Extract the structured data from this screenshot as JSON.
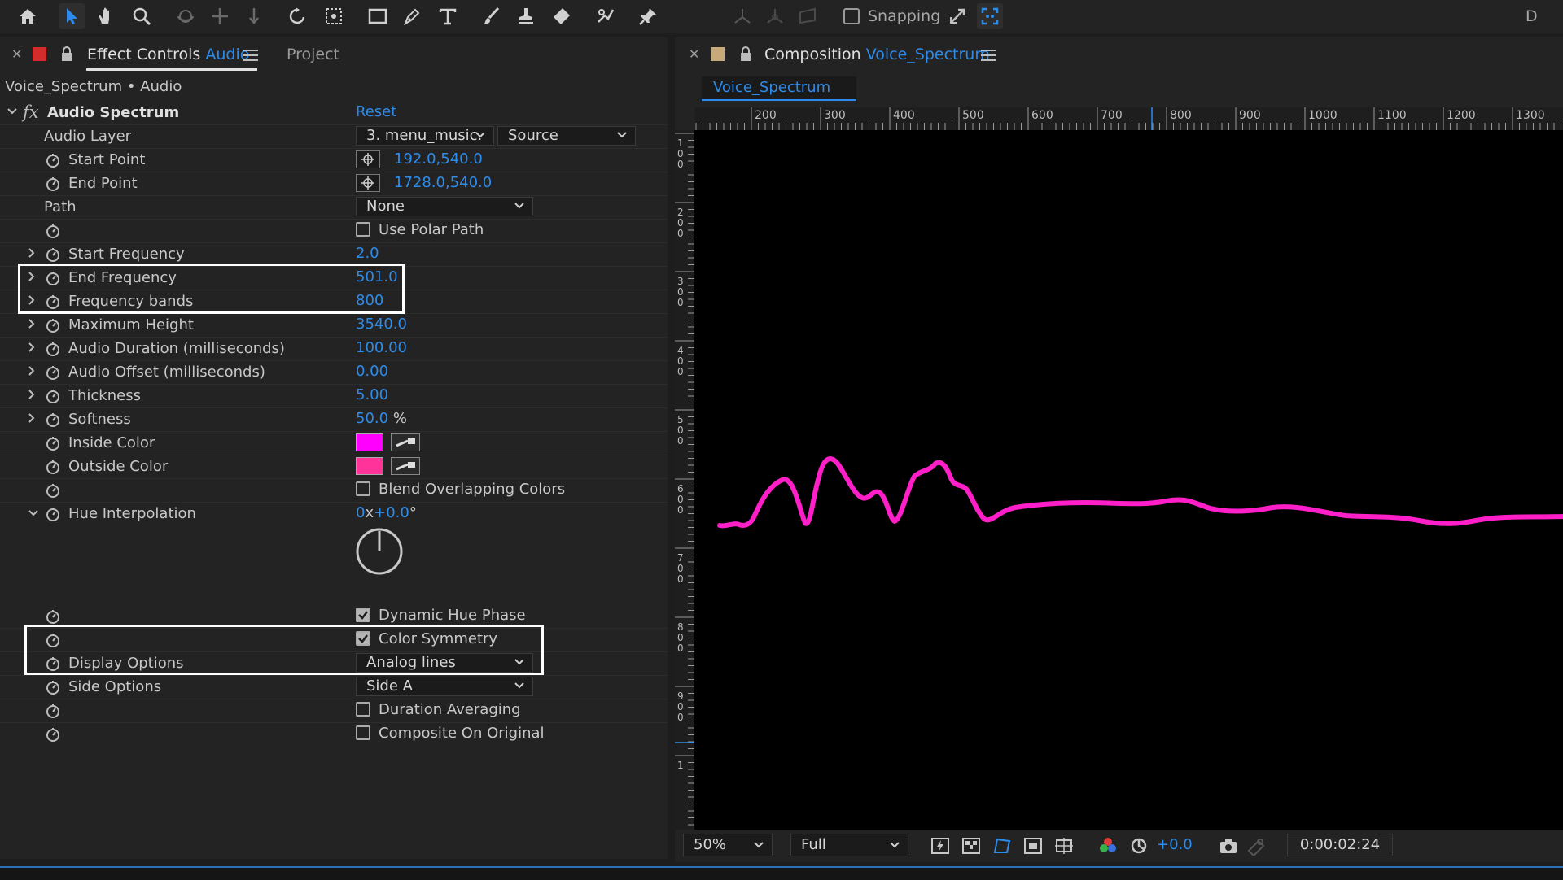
{
  "toolbar": {
    "snapping_label": "Snapping",
    "right_label": "D"
  },
  "effect_controls": {
    "tab_title_prefix": "Effect Controls",
    "tab_title_layer": "Audio",
    "label_color": "#d42c2c",
    "project_tab": "Project",
    "layer_path": "Voice_Spectrum • Audio",
    "effect": {
      "fx_label": "fx",
      "name": "Audio Spectrum",
      "reset_label": "Reset"
    },
    "audio_layer": {
      "label": "Audio Layer",
      "layer_value": "3. menu_music.",
      "source_value": "Source"
    },
    "start_point": {
      "label": "Start Point",
      "value": "192.0,540.0"
    },
    "end_point": {
      "label": "End Point",
      "value": "1728.0,540.0"
    },
    "path": {
      "label": "Path",
      "value": "None"
    },
    "use_polar_path": {
      "label": "Use Polar Path",
      "checked": false
    },
    "start_frequency": {
      "label": "Start Frequency",
      "value": "2.0"
    },
    "end_frequency": {
      "label": "End Frequency",
      "value": "501.0"
    },
    "frequency_bands": {
      "label": "Frequency bands",
      "value": "800"
    },
    "maximum_height": {
      "label": "Maximum Height",
      "value": "3540.0"
    },
    "audio_duration": {
      "label": "Audio Duration (milliseconds)",
      "value": "100.00"
    },
    "audio_offset": {
      "label": "Audio Offset (milliseconds)",
      "value": "0.00"
    },
    "thickness": {
      "label": "Thickness",
      "value": "5.00"
    },
    "softness": {
      "label": "Softness",
      "value": "50.0",
      "unit": "%"
    },
    "inside_color": {
      "label": "Inside Color",
      "color": "#ff00ff"
    },
    "outside_color": {
      "label": "Outside Color",
      "color": "#ff3399"
    },
    "blend_overlapping": {
      "label": "Blend Overlapping Colors",
      "checked": false
    },
    "hue_interpolation": {
      "label": "Hue Interpolation",
      "revolutions": "0",
      "x_label": "x",
      "degrees": "+0.0",
      "degree_unit": "°"
    },
    "dynamic_hue_phase": {
      "label": "Dynamic Hue Phase",
      "checked": true
    },
    "color_symmetry": {
      "label": "Color Symmetry",
      "checked": true
    },
    "display_options": {
      "label": "Display Options",
      "value": "Analog lines"
    },
    "side_options": {
      "label": "Side Options",
      "value": "Side A"
    },
    "duration_averaging": {
      "label": "Duration Averaging",
      "checked": false
    },
    "composite_on_original": {
      "label": "Composite On Original",
      "checked": false
    }
  },
  "composition": {
    "tab_title_prefix": "Composition",
    "tab_title_name": "Voice_Spectrum",
    "label_color": "#c8a97a",
    "subtab": "Voice_Spectrum",
    "ruler_h_labels": [
      "200",
      "300",
      "400",
      "500",
      "600",
      "700",
      "800",
      "900",
      "1000",
      "1100",
      "1200",
      "1300"
    ],
    "ruler_v_labels": [
      "100",
      "200",
      "300",
      "400",
      "500",
      "600",
      "700",
      "800",
      "900",
      "1"
    ],
    "waveform_color": "#ff1fc8",
    "zoom": "50%",
    "resolution": "Full",
    "exposure": "+0.0",
    "timecode": "0:00:02:24"
  }
}
